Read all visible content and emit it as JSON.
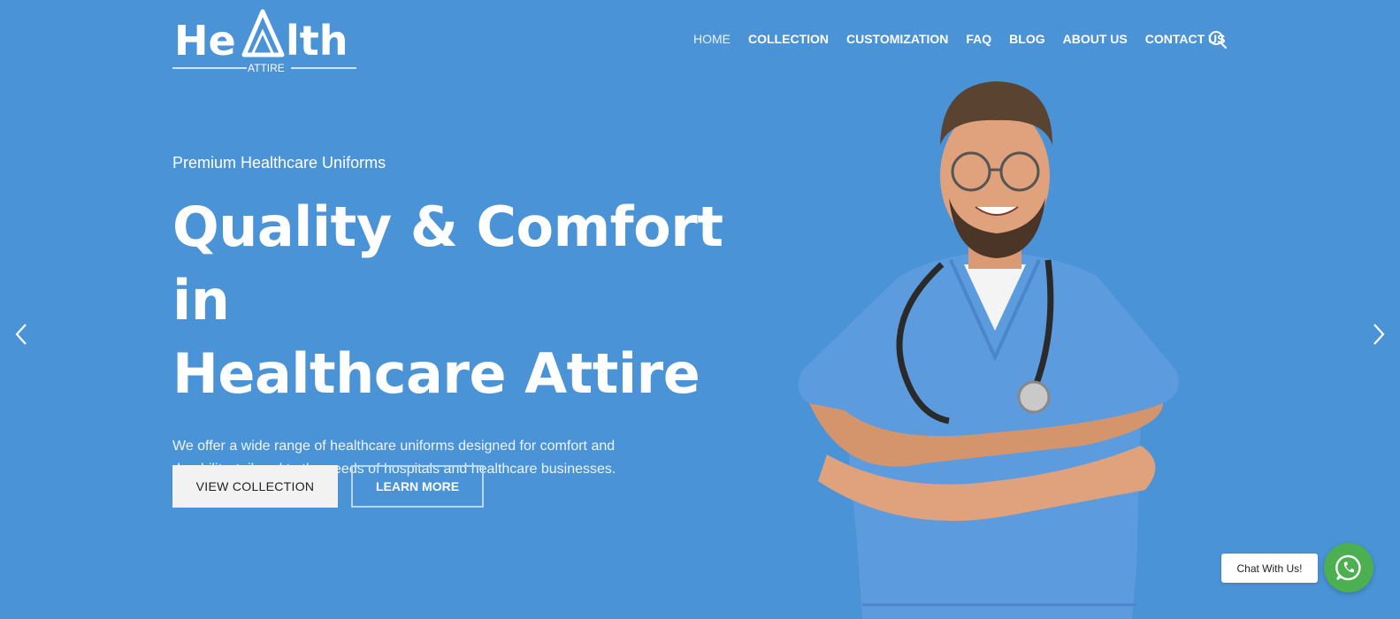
{
  "brand": {
    "logo_word_left": "He",
    "logo_word_right": "lth",
    "logo_sub": "ATTIRE",
    "colors": {
      "background": "#4a93d6",
      "text": "#ffffff",
      "whatsapp": "#4caf50"
    }
  },
  "nav": {
    "items": [
      {
        "label": "HOME",
        "active": true
      },
      {
        "label": "COLLECTION",
        "active": false
      },
      {
        "label": "CUSTOMIZATION",
        "active": false
      },
      {
        "label": "FAQ",
        "active": false
      },
      {
        "label": "BLOG",
        "active": false
      },
      {
        "label": "ABOUT US",
        "active": false
      },
      {
        "label": "CONTACT US",
        "active": false
      }
    ],
    "search_icon": "search-icon"
  },
  "hero": {
    "eyebrow": "Premium Healthcare Uniforms",
    "headline_line1": "Quality & Comfort in",
    "headline_line2": "Healthcare Attire",
    "description": "We offer a wide range of healthcare uniforms designed for comfort and durability, tailored to the needs of hospitals and healthcare businesses.",
    "primary_button": "VIEW COLLECTION",
    "secondary_button": "LEARN MORE",
    "prev_icon": "chevron-left-icon",
    "next_icon": "chevron-right-icon"
  },
  "chat": {
    "label": "Chat With Us!",
    "icon": "whatsapp-icon"
  }
}
